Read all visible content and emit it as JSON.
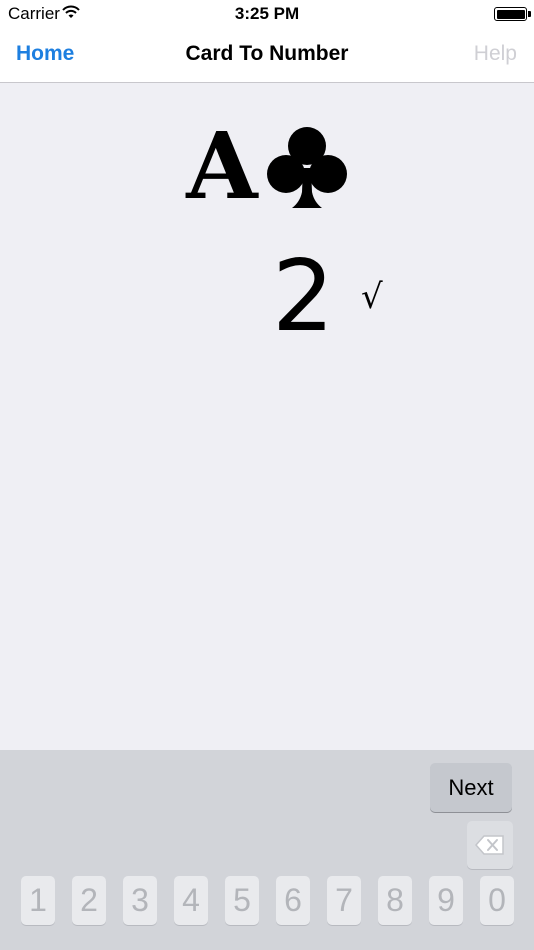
{
  "status_bar": {
    "carrier": "Carrier",
    "time": "3:25 PM",
    "wifi_icon": "wifi-icon",
    "battery_icon": "battery-icon"
  },
  "nav": {
    "back_label": "Home",
    "title": "Card To Number",
    "help_label": "Help"
  },
  "card": {
    "rank": "A",
    "suit_icon": "club-icon"
  },
  "answer": {
    "value": "2",
    "mark": "√"
  },
  "keyboard": {
    "next_label": "Next",
    "delete_icon": "backspace-icon",
    "digits": [
      "1",
      "2",
      "3",
      "4",
      "5",
      "6",
      "7",
      "8",
      "9",
      "0"
    ]
  },
  "colors": {
    "accent": "#1d7fe0",
    "background": "#efeff4",
    "keyboard": "#d2d4d9",
    "disabled_text": "#cfcfd4"
  }
}
